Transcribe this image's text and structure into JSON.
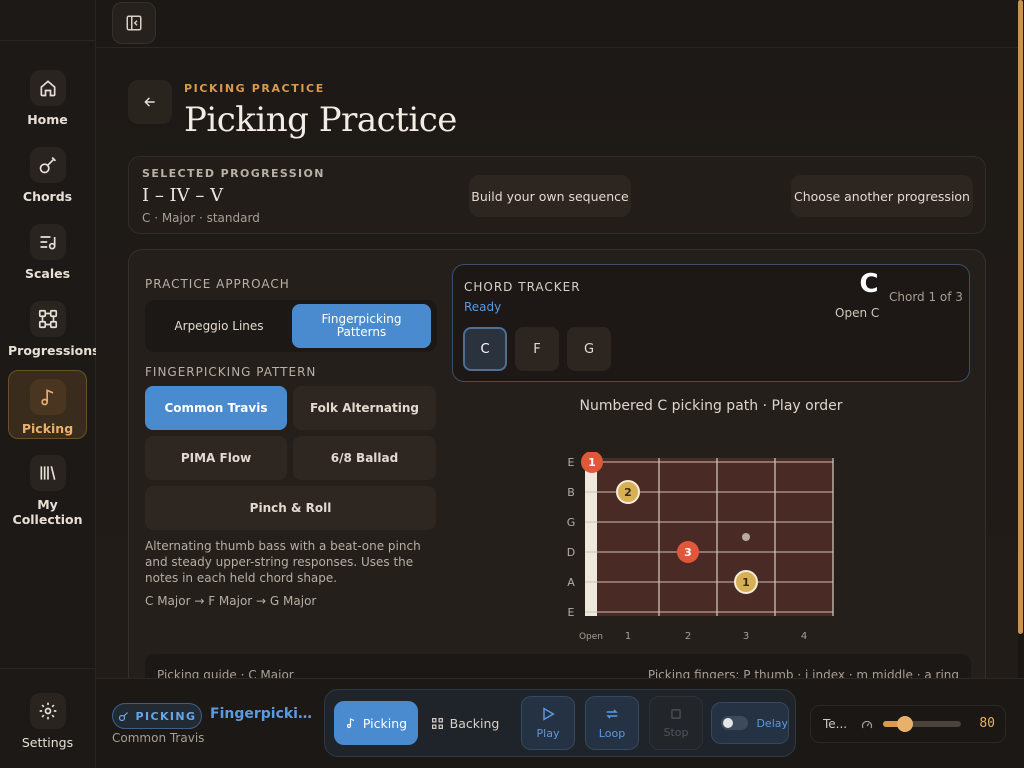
{
  "nav": {
    "items": [
      {
        "label": "Home",
        "icon": "home-icon"
      },
      {
        "label": "Chords",
        "icon": "guitar-icon"
      },
      {
        "label": "Scales",
        "icon": "scales-icon"
      },
      {
        "label": "Progressions",
        "icon": "progressions-icon"
      },
      {
        "label": "Picking",
        "icon": "music-note-icon",
        "active": true
      },
      {
        "label": "My\nCollection",
        "icon": "library-icon"
      }
    ],
    "settings_label": "Settings"
  },
  "header": {
    "breadcrumb": "PICKING PRACTICE",
    "title": "Picking Practice"
  },
  "progression": {
    "label": "SELECTED PROGRESSION",
    "value": "I – IV – V",
    "sub": "C · Major · standard",
    "build_label": "Build your own sequence",
    "choose_label": "Choose another progression"
  },
  "practice": {
    "approach_label": "PRACTICE APPROACH",
    "approach_options": [
      "Arpeggio Lines",
      "Fingerpicking Patterns"
    ],
    "approach_selected": "Fingerpicking Patterns",
    "pattern_label": "FINGERPICKING PATTERN",
    "patterns": [
      "Common Travis",
      "Folk Alternating",
      "PIMA Flow",
      "6/8 Ballad",
      "Pinch & Roll"
    ],
    "pattern_selected": "Common Travis",
    "description": "Alternating thumb bass with a beat-one pinch and steady upper-string responses. Uses the notes in each held chord shape.",
    "chord_sequence": "C Major → F Major → G Major"
  },
  "tracker": {
    "heading": "CHORD TRACKER",
    "status": "Ready",
    "current_chord": "C",
    "current_name": "Open C",
    "position": "Chord 1 of 3",
    "chords": [
      "C",
      "F",
      "G"
    ]
  },
  "fretboard": {
    "title": "Numbered C picking path · Play order",
    "strings": [
      "E",
      "B",
      "G",
      "D",
      "A",
      "E"
    ],
    "fret_labels": [
      "Open",
      "1",
      "2",
      "3",
      "4"
    ],
    "markers": [
      {
        "string": 0,
        "fret": 0,
        "label": "1",
        "kind": "thumb"
      },
      {
        "string": 1,
        "fret": 1,
        "label": "2",
        "kind": "finger"
      },
      {
        "string": 3,
        "fret": 2,
        "label": "3",
        "kind": "thumb"
      },
      {
        "string": 4,
        "fret": 3,
        "label": "1",
        "kind": "finger"
      }
    ],
    "inlay": {
      "string": 2.5,
      "fret": 3
    },
    "colors": {
      "wood": "#4a2a24",
      "thumb": "#e0573a",
      "finger": "#d7b055"
    }
  },
  "guide": {
    "left": "Picking guide · C Major",
    "right": "Picking fingers: P thumb · i index · m middle · a ring"
  },
  "bottom": {
    "chip": "PICKING",
    "now_title": "Fingerpicking Patterns",
    "now_sub": "Common Travis",
    "mode_picking": "Picking",
    "mode_backing": "Backing",
    "play": "Play",
    "loop": "Loop",
    "stop": "Stop",
    "delay": "Delay",
    "tempo_label": "Te...",
    "tempo_value": "80",
    "tempo_fraction": 0.18
  },
  "colors": {
    "accent": "#d99a4e",
    "blue": "#4a8bd0"
  }
}
